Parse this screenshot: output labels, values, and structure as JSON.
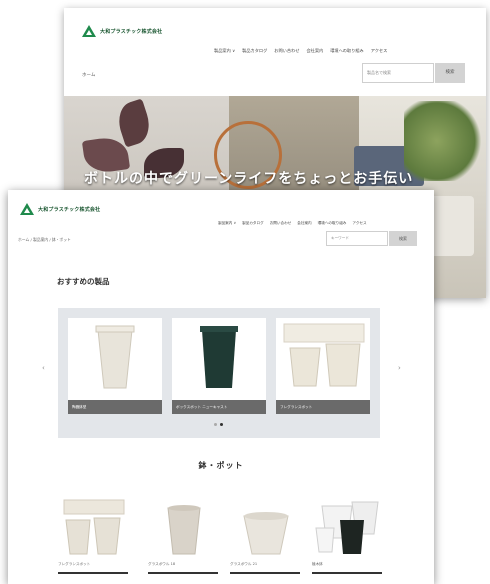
{
  "back_page": {
    "company_name": "大和プラスチック株式会社",
    "nav": [
      "製品案内 ∨",
      "製品カタログ",
      "お問い合わせ",
      "会社案内",
      "環境への取り組み",
      "アクセス"
    ],
    "breadcrumb": "ホーム",
    "search_placeholder": "製品名で検索",
    "search_button": "検索",
    "hero_caption": "ボトルの中でグリーンライフをちょっとお手伝い"
  },
  "front_page": {
    "company_name": "大和プラスチック株式会社",
    "nav": [
      "製品案内 ∨",
      "製品カタログ",
      "お問い合わせ",
      "会社案内",
      "環境への取り組み",
      "アクセス"
    ],
    "breadcrumb": "ホーム / 製品案内 / 鉢・ポット",
    "search_placeholder": "キーワード",
    "search_button": "検索",
    "recommended_title": "おすすめの製品",
    "carousel": {
      "prev_icon": "chevron-left-icon",
      "next_icon": "chevron-right-icon",
      "cards": [
        {
          "label": "陶器鉢型",
          "pot_color": "#e8e4da"
        },
        {
          "label": "ボックスポット ニューキャスト",
          "pot_color": "#1f3a34"
        },
        {
          "label": "フレグランスポット",
          "pot_color": "#ebe6d9"
        }
      ],
      "dots": 2,
      "active_dot": 1
    },
    "category_title": "鉢・ポット",
    "products": [
      {
        "name": "フレグランスポット",
        "pot_color": "#e6e1d6"
      },
      {
        "name": "グラスボウル 18",
        "pot_color": "#d9d3c9"
      },
      {
        "name": "グラスボウル 21",
        "pot_color": "#e9e5dd"
      },
      {
        "name": "植木鉢",
        "pot_color": "#1e2522"
      }
    ]
  }
}
